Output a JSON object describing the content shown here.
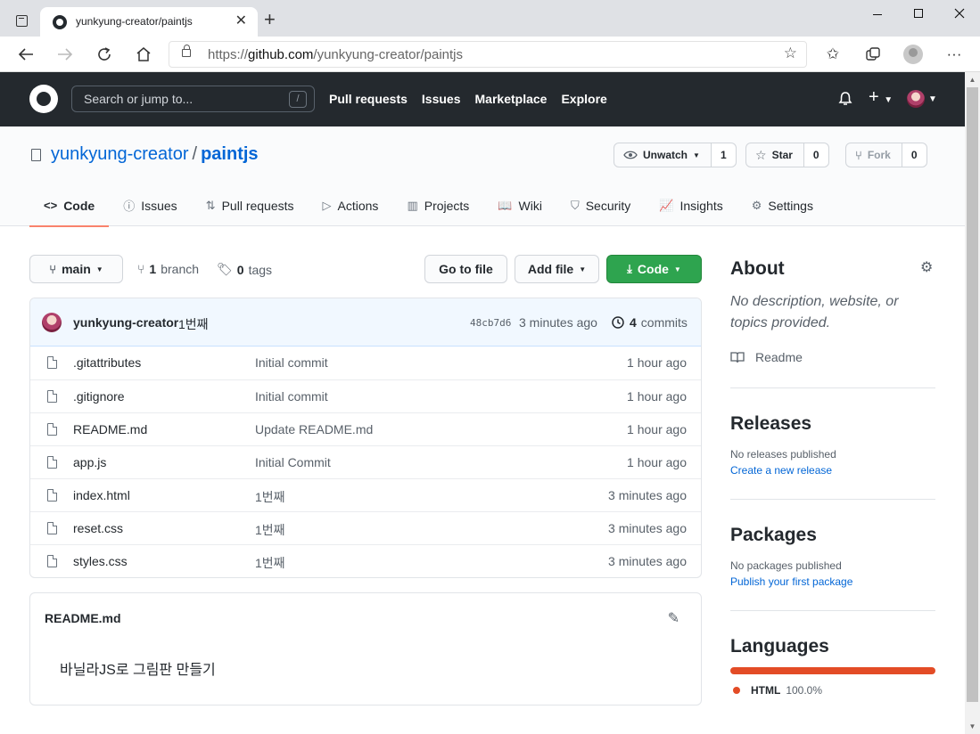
{
  "browser": {
    "tab_title": "yunkyung-creator/paintjs",
    "tab_close": "✕",
    "new_tab": "+",
    "url_prefix": "https://",
    "url_host": "github.com",
    "url_path": "/yunkyung-creator/paintjs"
  },
  "gh_header": {
    "search_placeholder": "Search or jump to...",
    "search_shortcut": "/",
    "nav": [
      "Pull requests",
      "Issues",
      "Marketplace",
      "Explore"
    ]
  },
  "repo": {
    "owner": "yunkyung-creator",
    "separator": "/",
    "name": "paintjs",
    "unwatch_label": "Unwatch",
    "unwatch_count": "1",
    "star_label": "Star",
    "star_count": "0",
    "fork_label": "Fork",
    "fork_count": "0"
  },
  "tabs": [
    {
      "label": "Code",
      "icon": "<>"
    },
    {
      "label": "Issues",
      "icon": "ⓘ"
    },
    {
      "label": "Pull requests",
      "icon": "⇅"
    },
    {
      "label": "Actions",
      "icon": "▷"
    },
    {
      "label": "Projects",
      "icon": "▥"
    },
    {
      "label": "Wiki",
      "icon": "📖"
    },
    {
      "label": "Security",
      "icon": "⛉"
    },
    {
      "label": "Insights",
      "icon": "📈"
    },
    {
      "label": "Settings",
      "icon": "⚙"
    }
  ],
  "toolbar": {
    "branch": "main",
    "branch_count": "1",
    "branch_label": "branch",
    "tag_count": "0",
    "tag_label": "tags",
    "go_to_file": "Go to file",
    "add_file": "Add file",
    "code": "Code"
  },
  "commit": {
    "author": "yunkyung-creator",
    "message": "1번째",
    "sha": "48cb7d6",
    "time": "3 minutes ago",
    "count": "4",
    "count_label": "commits"
  },
  "files": [
    {
      "name": ".gitattributes",
      "commit": "Initial commit",
      "age": "1 hour ago"
    },
    {
      "name": ".gitignore",
      "commit": "Initial commit",
      "age": "1 hour ago"
    },
    {
      "name": "README.md",
      "commit": "Update README.md",
      "age": "1 hour ago"
    },
    {
      "name": "app.js",
      "commit": "Initial Commit",
      "age": "1 hour ago"
    },
    {
      "name": "index.html",
      "commit": "1번째",
      "age": "3 minutes ago"
    },
    {
      "name": "reset.css",
      "commit": "1번째",
      "age": "3 minutes ago"
    },
    {
      "name": "styles.css",
      "commit": "1번째",
      "age": "3 minutes ago"
    }
  ],
  "readme": {
    "title": "README.md",
    "body": "바닐라JS로 그림판 만들기"
  },
  "sidebar": {
    "about_title": "About",
    "about_desc": "No description, website, or topics provided.",
    "readme_link": "Readme",
    "releases_title": "Releases",
    "releases_none": "No releases published",
    "releases_link": "Create a new release",
    "packages_title": "Packages",
    "packages_none": "No packages published",
    "packages_link": "Publish your first package",
    "languages_title": "Languages",
    "language_name": "HTML",
    "language_pct": "100.0%",
    "language_color": "#e34c26"
  }
}
